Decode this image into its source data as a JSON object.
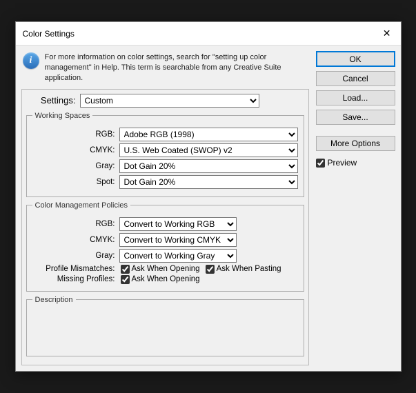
{
  "title": "Color Settings",
  "info_text": "For more information on color settings, search for \"setting up color management\" in Help. This term is searchable from any Creative Suite application.",
  "settings_label": "Settings:",
  "settings_value": "Custom",
  "working_spaces": {
    "legend": "Working Spaces",
    "rgb_label": "RGB:",
    "rgb_value": "Adobe RGB (1998)",
    "cmyk_label": "CMYK:",
    "cmyk_value": "U.S. Web Coated (SWOP) v2",
    "gray_label": "Gray:",
    "gray_value": "Dot Gain 20%",
    "spot_label": "Spot:",
    "spot_value": "Dot Gain 20%"
  },
  "policies": {
    "legend": "Color Management Policies",
    "rgb_label": "RGB:",
    "rgb_value": "Convert to Working RGB",
    "cmyk_label": "CMYK:",
    "cmyk_value": "Convert to Working CMYK",
    "gray_label": "Gray:",
    "gray_value": "Convert to Working Gray",
    "mismatch_label": "Profile Mismatches:",
    "mismatch_open": "Ask When Opening",
    "mismatch_paste": "Ask When Pasting",
    "missing_label": "Missing Profiles:",
    "missing_open": "Ask When Opening"
  },
  "description_legend": "Description",
  "buttons": {
    "ok": "OK",
    "cancel": "Cancel",
    "load": "Load...",
    "save": "Save...",
    "more": "More Options"
  },
  "preview_label": "Preview"
}
